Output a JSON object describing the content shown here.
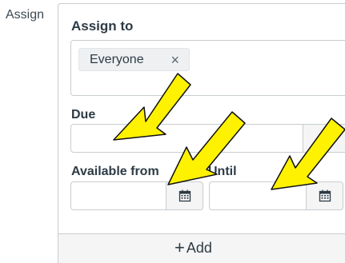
{
  "left_label": "Assign",
  "card": {
    "title": "Assign to",
    "assignees": [
      {
        "label": "Everyone",
        "remove_glyph": "×"
      }
    ],
    "due": {
      "label": "Due",
      "value": ""
    },
    "available_from": {
      "label": "Available from",
      "value": ""
    },
    "until": {
      "label": "Until",
      "value": ""
    },
    "add_button": {
      "icon": "plus-icon",
      "label": "Add"
    }
  },
  "colors": {
    "text": "#2d3b45",
    "border": "#c7cdd1",
    "footer_bg": "#f5f5f5",
    "token_bg": "#eef0f2",
    "arrow_fill": "#fff200",
    "arrow_stroke": "#111111"
  }
}
